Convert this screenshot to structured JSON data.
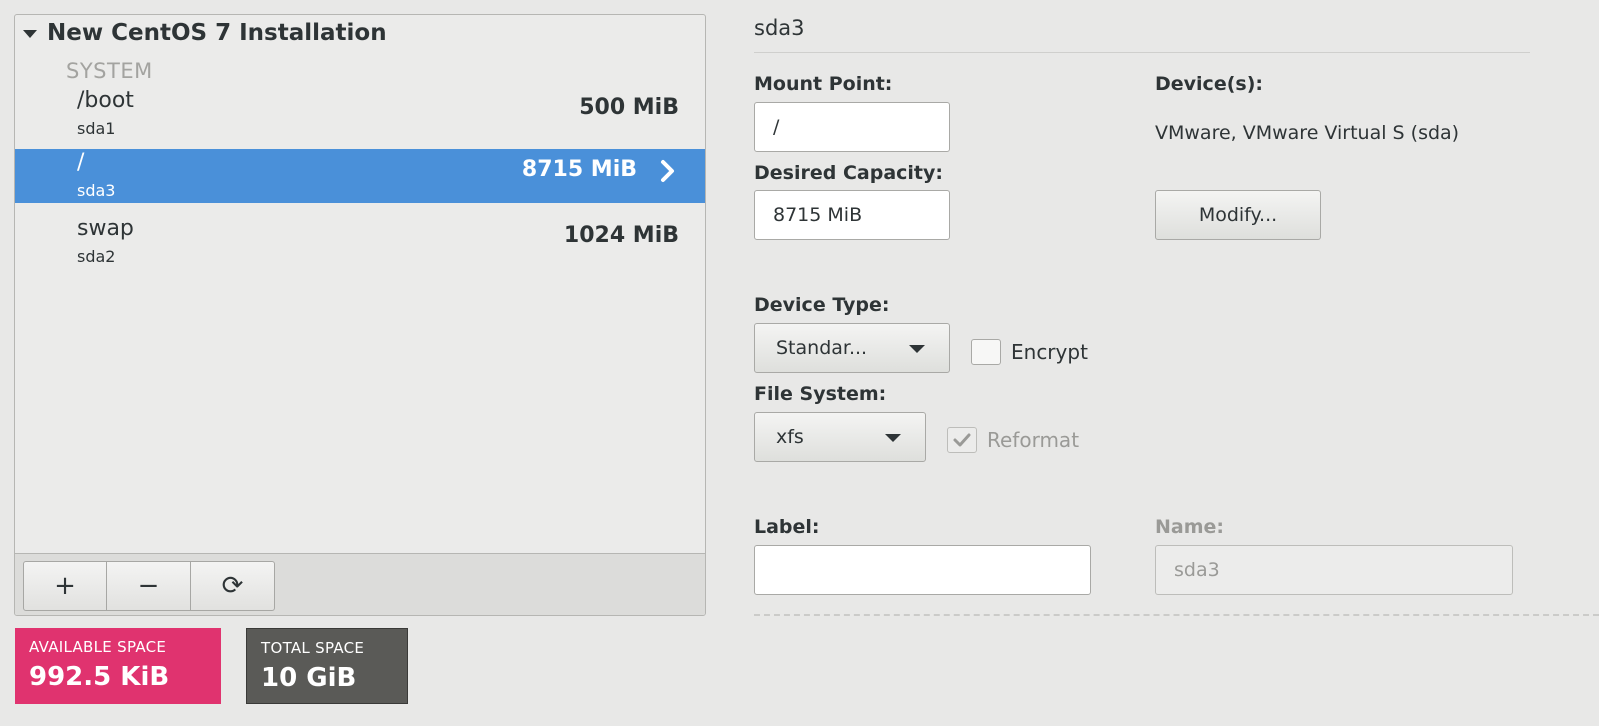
{
  "tree": {
    "title": "New CentOS 7 Installation",
    "section": "SYSTEM",
    "mounts": [
      {
        "name": "/boot",
        "device": "sda1",
        "size": "500 MiB"
      },
      {
        "name": "/",
        "device": "sda3",
        "size": "8715 MiB"
      },
      {
        "name": "swap",
        "device": "sda2",
        "size": "1024 MiB"
      }
    ],
    "toolbar": {
      "add": "+",
      "remove": "−",
      "refresh": "⟳"
    }
  },
  "space": {
    "available_label": "AVAILABLE SPACE",
    "available_value": "992.5 KiB",
    "total_label": "TOTAL SPACE",
    "total_value": "10 GiB"
  },
  "detail": {
    "heading": "sda3",
    "mount_point_label": "Mount Point:",
    "mount_point_value": "/",
    "desired_capacity_label": "Desired Capacity:",
    "desired_capacity_value": "8715 MiB",
    "devices_label": "Device(s):",
    "devices_value": "VMware, VMware Virtual S (sda)",
    "modify_label": "Modify...",
    "device_type_label": "Device Type:",
    "device_type_value": "Standar...",
    "encrypt_label": "Encrypt",
    "file_system_label": "File System:",
    "file_system_value": "xfs",
    "reformat_label": "Reformat",
    "label_label": "Label:",
    "label_value": "",
    "name_label": "Name:",
    "name_value": "sda3"
  },
  "colors": {
    "selection": "#4a90d9",
    "available": "#e0336f",
    "total": "#5a5a57"
  }
}
